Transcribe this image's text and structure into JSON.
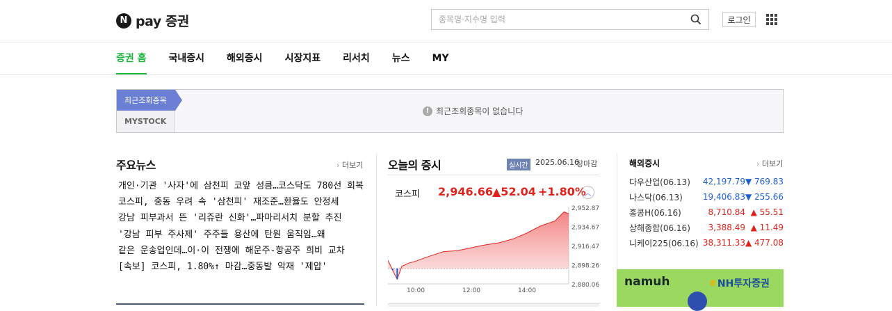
{
  "header": {
    "logo_icon": "N",
    "logo_text": "pay 증권",
    "search_placeholder": "종목명·지수명 입력",
    "login_label": "로그인"
  },
  "nav": {
    "tabs": [
      {
        "label": "증권 홈",
        "active": true
      },
      {
        "label": "국내증시",
        "active": false
      },
      {
        "label": "해외증시",
        "active": false
      },
      {
        "label": "시장지표",
        "active": false
      },
      {
        "label": "리서치",
        "active": false
      },
      {
        "label": "뉴스",
        "active": false
      },
      {
        "label": "MY",
        "active": false
      }
    ]
  },
  "recent": {
    "tab_recent": "최근조회종목",
    "tab_mystock": "MYSTOCK",
    "empty_message": "최근조회종목이 없습니다"
  },
  "news": {
    "title": "주요뉴스",
    "more_label": "더보기",
    "items": [
      "개인·기관 '사자'에 삼천피 코앞 성큼…코스닥도 780선 회복",
      "코스피, 중동 우려 속 '삼천피' 재조준…환율도 안정세",
      "강남 피부과서 뜬 '리쥬란 신화'…파마리서치 분할 추진",
      "'강남 피부 주사제' 주주들 용산에 탄원 움직임…왜",
      "같은 운송업인데…이·이 전쟁에 해운주-항공주 희비 교차",
      "[속보] 코스피, 1.80%↑ 마감…중동발 악재 '제압'"
    ]
  },
  "today": {
    "title": "오늘의 증시",
    "realtime_badge": "실시간",
    "date": "2025.06.16",
    "status": "장마감",
    "kospi": {
      "name": "코스피",
      "value": "2,946.66",
      "change": "▲52.04",
      "change_pct": "+1.80%"
    },
    "collapse_icon": "chevron-up"
  },
  "overseas": {
    "title": "해외증시",
    "more_label": "더보기",
    "rows": [
      {
        "name": "다우산업(06.13)",
        "value": "42,197.79",
        "change": "▼ 769.83",
        "dir": "dn"
      },
      {
        "name": "나스닥(06.13)",
        "value": "19,406.83",
        "change": "▼ 255.66",
        "dir": "dn"
      },
      {
        "name": "홍콩H(06.16)",
        "value": "8,710.84",
        "change": "▲ 55.51",
        "dir": "up"
      },
      {
        "name": "상해종합(06.16)",
        "value": "3,388.49",
        "change": "▲ 11.49",
        "dir": "up"
      },
      {
        "name": "니케이225(06.16)",
        "value": "38,311.33",
        "change": "▲ 477.08",
        "dir": "up"
      }
    ]
  },
  "ad": {
    "brand": "namuh",
    "sponsor": "NH투자증권"
  },
  "colors": {
    "accent_green": "#1db53d",
    "up_red": "#e0221b",
    "down_blue": "#1d5fd1",
    "badge_blue": "#6b7fd4"
  },
  "chart_data": {
    "type": "area",
    "title": "",
    "x_ticks": [
      "10:00",
      "12:00",
      "14:00"
    ],
    "y_ticks": [
      "2,952.87",
      "2,934.67",
      "2,916.47",
      "2,898.26",
      "2,880.06"
    ],
    "ylim": [
      2880.06,
      2952.87
    ],
    "previous_close": 2894.62,
    "x": [
      "09:00",
      "09:10",
      "09:20",
      "09:30",
      "09:45",
      "10:00",
      "10:30",
      "11:00",
      "11:30",
      "12:00",
      "12:30",
      "13:00",
      "13:30",
      "14:00",
      "14:30",
      "15:00",
      "15:20",
      "15:30"
    ],
    "values": [
      2902.5,
      2893.0,
      2884.5,
      2896.8,
      2899.8,
      2901.7,
      2906.4,
      2910.8,
      2911.6,
      2914.5,
      2917.1,
      2919.2,
      2922.8,
      2928.5,
      2935.4,
      2939.8,
      2948.6,
      2946.7
    ]
  }
}
